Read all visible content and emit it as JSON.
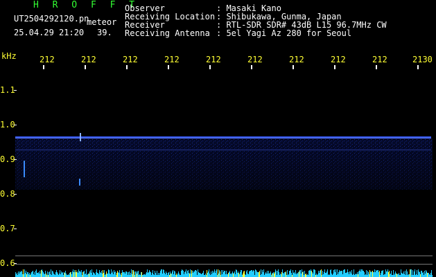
{
  "app": {
    "title": "H R O F F T",
    "file_label": "UT2504292120.pn",
    "mode_label": "meteor",
    "datetime": "25.04.29 21:20",
    "count": "39."
  },
  "info": {
    "rows": [
      {
        "label": "Observer",
        "value": ": Masaki Kano"
      },
      {
        "label": "Receiving Location",
        "value": ": Shibukawa, Gunma, Japan"
      },
      {
        "label": "Receiver",
        "value": ": RTL-SDR SDR# 43dB L15 96.7MHz CW"
      },
      {
        "label": "Receiving Antenna",
        "value": ": 5el Yagi Az 280 for Seoul"
      }
    ]
  },
  "axes": {
    "y_unit": "kHz",
    "y_ticks": [
      "1.1",
      "1.0",
      "0.9",
      "0.8",
      "0.7",
      "0.6"
    ],
    "x_ticks": [
      "212",
      "212",
      "212",
      "212",
      "212",
      "212",
      "212",
      "212",
      "212",
      "2130"
    ]
  },
  "colors": {
    "background": "#000000",
    "header_text": "#ffffff",
    "title_text": "#33ff33",
    "axis_text": "#ffff33",
    "signal": "#2a4cff",
    "noise_band": "#0a1a66"
  }
}
